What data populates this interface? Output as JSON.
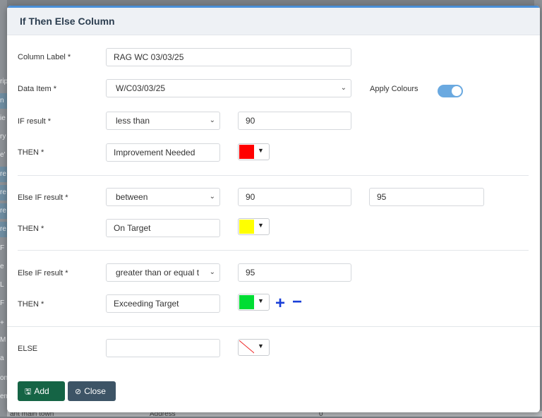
{
  "modal": {
    "title": "If Then Else Column",
    "column_label": {
      "label": "Column Label *",
      "value": "RAG WC 03/03/25"
    },
    "data_item": {
      "label": "Data Item *",
      "value": "W/C03/03/25"
    },
    "apply_colours": {
      "label": "Apply Colours",
      "enabled": true
    },
    "if_row": {
      "label": "IF result *",
      "operator": "less than",
      "value": "90",
      "then_label": "THEN *",
      "then_value": "Improvement Needed",
      "color": "#ff0000"
    },
    "else_if_1": {
      "label": "Else IF result *",
      "operator": "between",
      "value": "90",
      "value2": "95",
      "then_label": "THEN *",
      "then_value": "On Target",
      "color": "#ffff00"
    },
    "else_if_2": {
      "label": "Else IF result *",
      "operator": "greater than or equal t",
      "value": "95",
      "then_label": "THEN *",
      "then_value": "Exceeding Target",
      "color": "#00dd33"
    },
    "else_row": {
      "label": "ELSE",
      "value": "",
      "color": "none"
    },
    "buttons": {
      "add": "Add",
      "close": "Close"
    },
    "icons": {
      "add_icon": "save-icon",
      "close_icon": "ban-icon",
      "plus": "+",
      "minus": "−",
      "caret": "▼",
      "chevron": "⌄"
    }
  },
  "background": {
    "fragments": [
      "rip",
      "n",
      "ie",
      "ry",
      "e'",
      "re",
      "re",
      "re",
      "re",
      "F",
      "e",
      "L",
      "F",
      "+",
      "M",
      "a",
      "on",
      "em"
    ],
    "bottom_row": [
      "ant main town",
      "Address",
      "0"
    ]
  }
}
